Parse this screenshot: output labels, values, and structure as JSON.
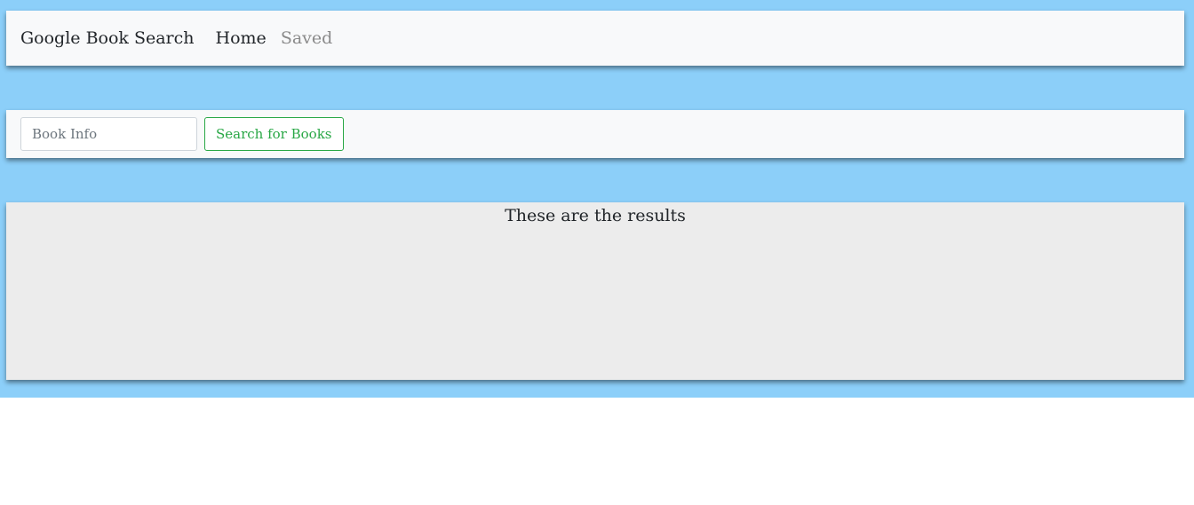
{
  "navbar": {
    "brand": "Google Book Search",
    "links": [
      {
        "label": "Home"
      },
      {
        "label": "Saved"
      }
    ]
  },
  "search": {
    "placeholder": "Book Info",
    "value": "",
    "button_label": "Search for Books"
  },
  "results": {
    "heading": "These are the results"
  },
  "colors": {
    "background": "#8ccff9",
    "panel": "#f8f9fa",
    "results_panel": "#ececec",
    "accent_green": "#28a745"
  }
}
